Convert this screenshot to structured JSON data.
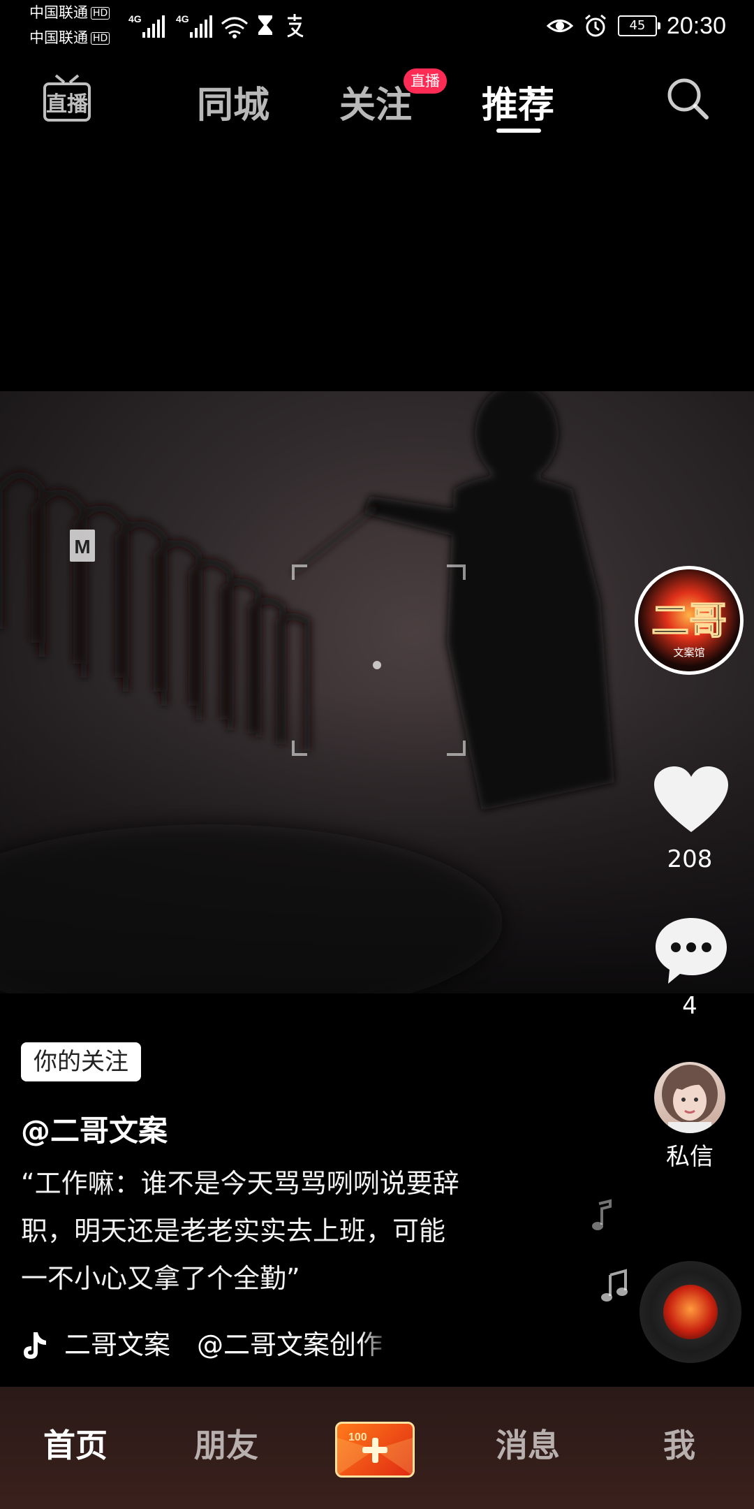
{
  "status_bar": {
    "carrier_1": "中国联通",
    "carrier_2": "中国联通",
    "hd": "HD",
    "network_1": "4G",
    "network_2": "4G",
    "battery": "45",
    "time": "20:30"
  },
  "top_nav": {
    "live_label": "直播",
    "tabs": [
      {
        "label": "同城"
      },
      {
        "label": "关注",
        "badge": "直播"
      },
      {
        "label": "推荐"
      }
    ],
    "active_tab": "推荐"
  },
  "video": {
    "watermark": "M"
  },
  "right_rail": {
    "author_avatar_text": "二哥",
    "author_avatar_sub": "文案馆",
    "likes": "208",
    "comments": "4",
    "dm_label": "私信"
  },
  "caption": {
    "follow_chip": "你的关注",
    "author": "@二哥文案",
    "lines": [
      "“工作嘛：谁不是今天骂骂咧咧说要辞",
      "职，明天还是老老实实去上班，可能",
      "一不小心又拿了个全勤”"
    ],
    "music": "二哥文案　@二哥文案创作"
  },
  "bottom_nav": {
    "items": [
      {
        "label": "首页"
      },
      {
        "label": "朋友"
      },
      {
        "label": "消息"
      },
      {
        "label": "我"
      }
    ],
    "create_badge": "100",
    "active": "首页"
  },
  "colors": {
    "accent": "#fe2c55",
    "background": "#000000"
  }
}
